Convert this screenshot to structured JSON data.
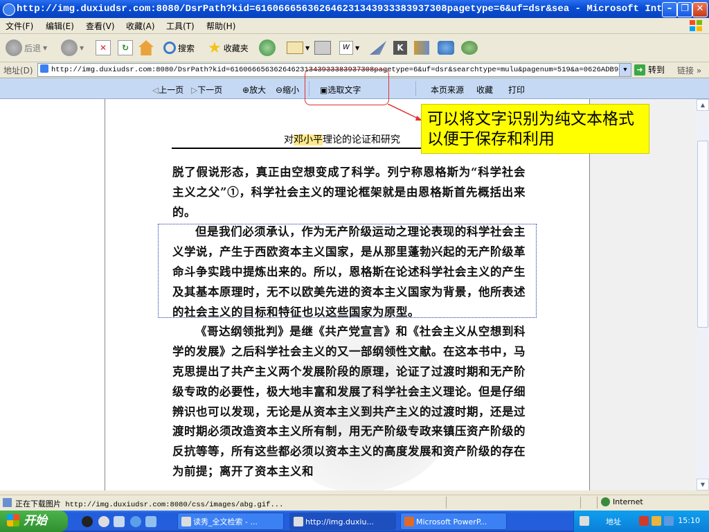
{
  "window": {
    "title": "http://img.duxiudsr.com:8080/DsrPath?kid=616066656362646231343933383937308pagetype=6&uf=dsr&sea - Microsoft Inter..."
  },
  "menu": [
    "文件(F)",
    "编辑(E)",
    "查看(V)",
    "收藏(A)",
    "工具(T)",
    "帮助(H)"
  ],
  "toolbar": {
    "back": "后退",
    "search": "搜索",
    "favorites": "收藏夹"
  },
  "address": {
    "label": "地址(D)",
    "url": "http://img.duxiudsr.com:8080/DsrPath?kid=616066656362646231343933383937308pagetype=6&uf=dsr&searchtype=mulu&pagenum=519&a=0626ADB98E9138",
    "go": "转到",
    "links": "链接"
  },
  "reader": {
    "prev": "上一页",
    "next": "下一页",
    "zoom_in": "放大",
    "zoom_out": "缩小",
    "select_text": "选取文字",
    "source": "本页来源",
    "favorite": "收藏",
    "print": "打印"
  },
  "page": {
    "header_pre": "对",
    "header_hl": "邓小平",
    "header_post": "理论的论证和研究",
    "paragraphs": [
      "脱了假说形态，真正由空想变成了科学。列宁称恩格斯为“科学社会主义之父”①，科学社会主义的理论框架就是由恩格斯首先概括出来的。",
      "但是我们必须承认，作为无产阶级运动之理论表现的科学社会主义学说，产生于西欧资本主义国家，是从那里蓬勃兴起的无产阶级革命斗争实践中提炼出来的。所以，恩格斯在论述科学社会主义的产生及其基本原理时，无不以欧美先进的资本主义国家为背景，他所表述的社会主义的目标和特征也以这些国家为原型。",
      "《哥达纲领批判》是继《共产党宣言》和《社会主义从空想到科学的发展》之后科学社会主义的又一部纲领性文献。在这本书中，马克思提出了共产主义两个发展阶段的原理，论证了过渡时期和无产阶级专政的必要性，极大地丰富和发展了科学社会主义理论。但是仔细辨识也可以发现，无论是从资本主义到共产主义的过渡时期，还是过渡时期必须改造资本主义所有制，用无产阶级专政来镇压资产阶级的反抗等等，所有这些都必须以资本主义的高度发展和资产阶级的存在为前提；离开了资本主义和"
    ]
  },
  "callout": {
    "text": "可以将文字识别为纯文本格式以便于保存和利用"
  },
  "status": {
    "prefix": "正在下载图片",
    "url": "http://img.duxiudsr.com:8080/css/images/abg.gif...",
    "zone": "Internet"
  },
  "taskbar": {
    "start": "开始",
    "tasks": [
      "读秀_全文检索 - ...",
      "http://img.duxiu...",
      "Microsoft PowerP..."
    ],
    "tray_address": "地址",
    "clock": "15:10"
  },
  "colors": {
    "callout_bg": "#ffff00",
    "highlight": "#ffe98a",
    "annotation_red": "#e03030",
    "selection_border": "#1a2fa6"
  }
}
